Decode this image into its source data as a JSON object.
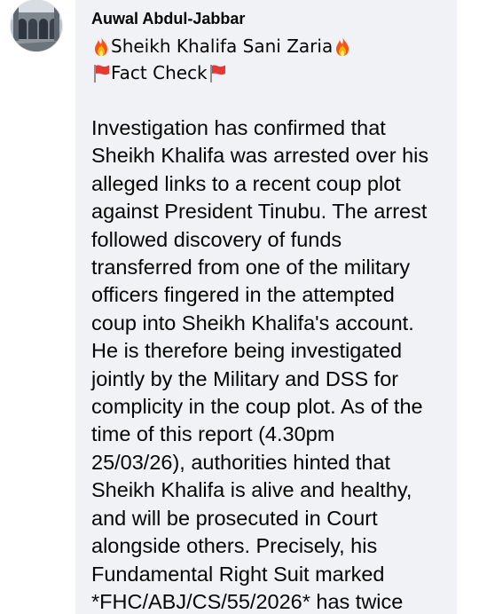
{
  "comment": {
    "author": "Auwal Abdul-Jabbar",
    "title_line": "Sheikh Khalifa Sani Zaria",
    "subtitle_line": "Fact Check",
    "title_emoji": "fire-emoji",
    "subtitle_emoji": "red-flag-emoji",
    "body_lines": [
      "Investigation has confirmed that",
      "Sheikh Khalifa was arrested over his",
      "alleged links to a recent coup plot",
      "against President Tinubu. The arrest",
      "followed discovery of funds",
      "transferred from one of the military",
      "officers fingered in the attempted",
      "coup into Sheikh Khalifa's account.",
      "He is therefore being investigated",
      "jointly by the Military and DSS for",
      "complicity in the coup plot. As of the",
      "time of this report (4.30pm",
      "25/03/26), authorities hinted that",
      "Sheikh Khalifa is alive and healthy,",
      "and will be prosecuted in Court",
      "alongside others. Precisely, his",
      "Fundamental Right Suit marked",
      "*FHC/ABJ/CS/55/2026* has twice"
    ]
  },
  "colors": {
    "bubble_bg": "#f0f2f5",
    "text": "#050505",
    "page_bg": "#ffffff"
  }
}
